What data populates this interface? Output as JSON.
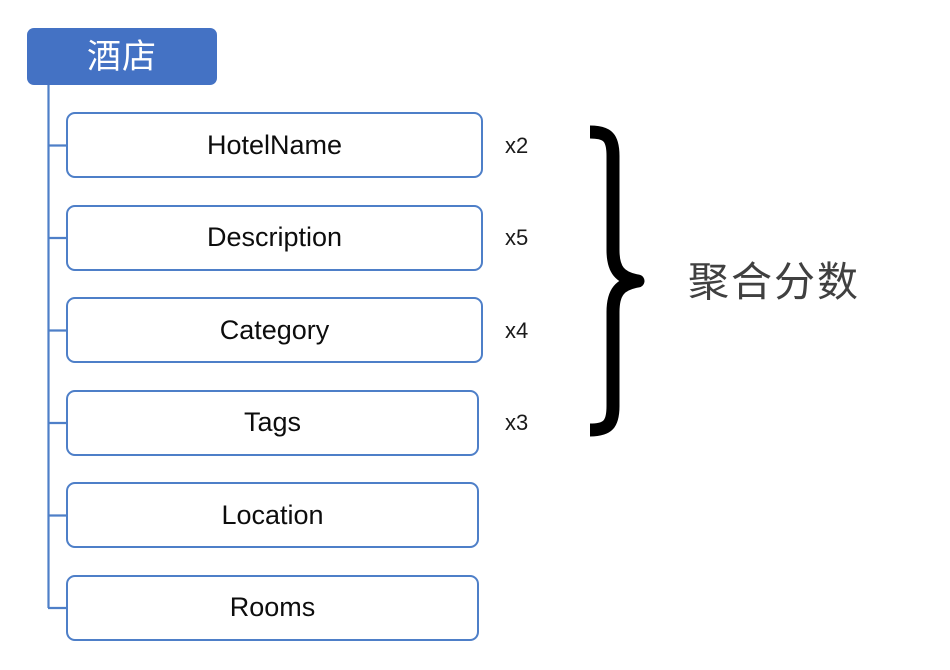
{
  "diagram": {
    "type": "tree",
    "title_node": {
      "label": "酒店",
      "fill_color": "#4472C4",
      "text_color": "#FFFFFF"
    },
    "fields": [
      {
        "label": "HotelName",
        "multiplier": "x2",
        "boosted": true
      },
      {
        "label": "Description",
        "multiplier": "x5",
        "boosted": true
      },
      {
        "label": "Category",
        "multiplier": "x4",
        "boosted": true
      },
      {
        "label": "Tags",
        "multiplier": "x3",
        "boosted": true
      },
      {
        "label": "Location",
        "multiplier": "",
        "boosted": false
      },
      {
        "label": "Rooms",
        "multiplier": "",
        "boosted": false
      }
    ],
    "annotation": {
      "brace_label": "聚合分数",
      "brace_color": "#000000",
      "label_color": "#404040"
    },
    "colors": {
      "node_border": "#4E7FC8",
      "node_fill": "#FFFFFF",
      "connector": "#4E7FC8",
      "field_text": "#0D0D0D",
      "multiplier_text": "#1A1A1A"
    }
  }
}
